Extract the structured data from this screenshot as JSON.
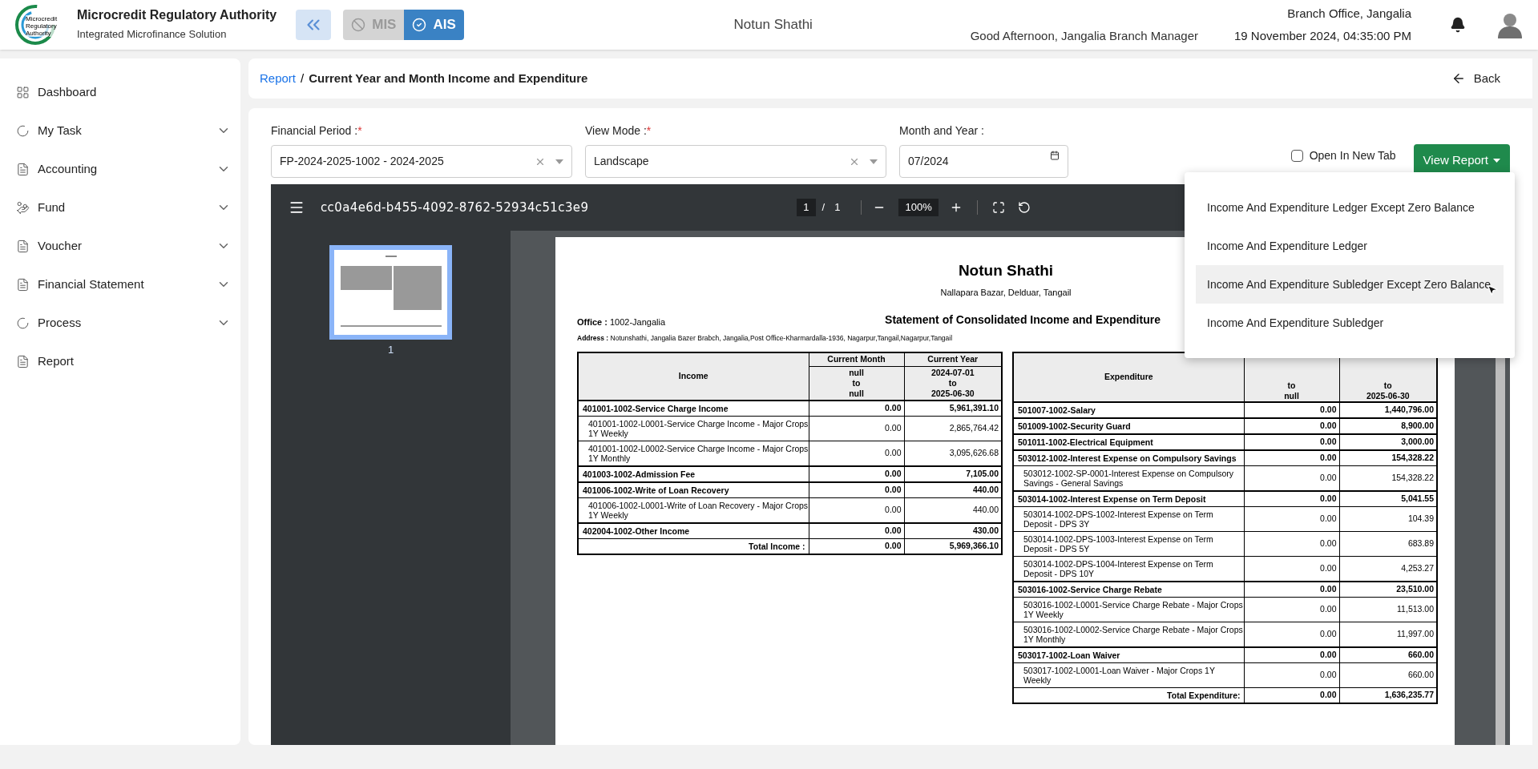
{
  "header": {
    "logo_text": "Microcredit Regulatory Authority",
    "org_name": "Microcredit Regulatory Authority",
    "org_subtitle": "Integrated Microfinance Solution",
    "modes": [
      {
        "label": "MIS",
        "selected": false
      },
      {
        "label": "AIS",
        "selected": true
      }
    ],
    "center_title": "Notun Shathi",
    "greeting": "Good Afternoon, Jangalia Branch Manager",
    "branch": "Branch Office, Jangalia",
    "datetime": "19 November 2024, 04:35:00 PM"
  },
  "sidebar": {
    "items": [
      {
        "label": "Dashboard",
        "has_submenu": false
      },
      {
        "label": "My Task",
        "has_submenu": true
      },
      {
        "label": "Accounting",
        "has_submenu": true
      },
      {
        "label": "Fund",
        "has_submenu": true
      },
      {
        "label": "Voucher",
        "has_submenu": true
      },
      {
        "label": "Financial Statement",
        "has_submenu": true
      },
      {
        "label": "Process",
        "has_submenu": true
      },
      {
        "label": "Report",
        "has_submenu": false
      }
    ]
  },
  "breadcrumb": {
    "link": "Report",
    "separator": "/",
    "current": "Current Year and Month Income and Expenditure",
    "back": "Back"
  },
  "filters": [
    {
      "kind": "select",
      "label": "Financial Period :",
      "required_mark": "*",
      "value": "FP-2024-2025-1002 - 2024-2025"
    },
    {
      "kind": "select",
      "label": "View Mode :",
      "required_mark": "*",
      "value": "Landscape"
    },
    {
      "kind": "date",
      "label": "Month and Year :",
      "value": "07/2024"
    }
  ],
  "open_in_new_tab": {
    "label": "Open In New Tab",
    "checked": false
  },
  "view_report": {
    "label": "View Report",
    "expanded": true,
    "options": [
      {
        "label": "Income And Expenditure Ledger Except Zero Balance",
        "selected": false
      },
      {
        "label": "Income And Expenditure Ledger",
        "selected": false
      },
      {
        "label": "Income And Expenditure Subledger Except Zero Balance",
        "selected": true
      },
      {
        "label": "Income And Expenditure Subledger",
        "selected": false
      }
    ]
  },
  "pdf_viewer": {
    "file_name": "cc0a4e6d-b455-4092-8762-52934c51c3e9",
    "page": "1",
    "page_separator": "/",
    "page_count": "1",
    "zoom": "100%",
    "thumbnail_label": "1",
    "document": {
      "title": "Notun Shathi",
      "address_line": "Nallapara Bazar, Delduar, Tangail",
      "office_label": "Office :",
      "office": "1002-Jangalia",
      "statement_title": "Statement of Consolidated Income and Expenditure",
      "address_label": "Address :",
      "address": "Notunshathi, Jangalia Bazer Brabch, Jangalia,Post Office-Kharmardalla-1936, Nagarpur,Tangail,Nagarpur,Tangail",
      "income_table": {
        "columns": [
          {
            "label": "Income"
          },
          {
            "label": "Current Month",
            "range": [
              "null",
              "to",
              "null"
            ]
          },
          {
            "label": "Current Year",
            "range": [
              "2024-07-01",
              "to",
              "2025-06-30"
            ]
          }
        ],
        "rows": [
          {
            "kind": "group",
            "account": "401001-1002-Service Charge Income",
            "current_month": "0.00",
            "current_year": "5,961,391.10"
          },
          {
            "kind": "sub",
            "account": "401001-1002-L0001-Service Charge Income - Major Crops 1Y Weekly",
            "current_month": "0.00",
            "current_year": "2,865,764.42"
          },
          {
            "kind": "sub",
            "account": "401001-1002-L0002-Service Charge Income - Major Crops 1Y Monthly",
            "current_month": "0.00",
            "current_year": "3,095,626.68"
          },
          {
            "kind": "group",
            "account": "401003-1002-Admission Fee",
            "current_month": "0.00",
            "current_year": "7,105.00"
          },
          {
            "kind": "group",
            "account": "401006-1002-Write of Loan Recovery",
            "current_month": "0.00",
            "current_year": "440.00"
          },
          {
            "kind": "sub",
            "account": "401006-1002-L0001-Write of Loan Recovery - Major Crops 1Y Weekly",
            "current_month": "0.00",
            "current_year": "440.00"
          },
          {
            "kind": "group",
            "account": "402004-1002-Other Income",
            "current_month": "0.00",
            "current_year": "430.00"
          },
          {
            "kind": "total",
            "account": "Total Income :",
            "current_month": "0.00",
            "current_year": "5,969,366.10"
          }
        ]
      },
      "expenditure_table": {
        "columns": [
          {
            "label": "Expenditure"
          },
          {
            "range": [
              "to",
              "null"
            ]
          },
          {
            "range": [
              "to",
              "2025-06-30"
            ]
          }
        ],
        "rows": [
          {
            "kind": "group",
            "account": "501007-1002-Salary",
            "current_month": "0.00",
            "current_year": "1,440,796.00"
          },
          {
            "kind": "group",
            "account": "501009-1002-Security Guard",
            "current_month": "0.00",
            "current_year": "8,900.00"
          },
          {
            "kind": "group",
            "account": "501011-1002-Electrical Equipment",
            "current_month": "0.00",
            "current_year": "3,000.00"
          },
          {
            "kind": "group",
            "account": "503012-1002-Interest Expense on Compulsory Savings",
            "current_month": "0.00",
            "current_year": "154,328.22"
          },
          {
            "kind": "sub",
            "account": "503012-1002-SP-0001-Interest Expense on Compulsory Savings - General Savings",
            "current_month": "0.00",
            "current_year": "154,328.22"
          },
          {
            "kind": "group",
            "account": "503014-1002-Interest Expense on Term Deposit",
            "current_month": "0.00",
            "current_year": "5,041.55"
          },
          {
            "kind": "sub",
            "account": "503014-1002-DPS-1002-Interest Expense on Term Deposit - DPS 3Y",
            "current_month": "0.00",
            "current_year": "104.39"
          },
          {
            "kind": "sub",
            "account": "503014-1002-DPS-1003-Interest Expense on Term Deposit - DPS 5Y",
            "current_month": "0.00",
            "current_year": "683.89"
          },
          {
            "kind": "sub",
            "account": "503014-1002-DPS-1004-Interest Expense on Term Deposit - DPS 10Y",
            "current_month": "0.00",
            "current_year": "4,253.27"
          },
          {
            "kind": "group",
            "account": "503016-1002-Service Charge Rebate",
            "current_month": "0.00",
            "current_year": "23,510.00"
          },
          {
            "kind": "sub",
            "account": "503016-1002-L0001-Service Charge Rebate - Major Crops 1Y Weekly",
            "current_month": "0.00",
            "current_year": "11,513.00"
          },
          {
            "kind": "sub",
            "account": "503016-1002-L0002-Service Charge Rebate - Major Crops 1Y Monthly",
            "current_month": "0.00",
            "current_year": "11,997.00"
          },
          {
            "kind": "group",
            "account": "503017-1002-Loan Waiver",
            "current_month": "0.00",
            "current_year": "660.00"
          },
          {
            "kind": "sub",
            "account": "503017-1002-L0001-Loan Waiver - Major Crops 1Y Weekly",
            "current_month": "0.00",
            "current_year": "660.00"
          },
          {
            "kind": "total",
            "account": "Total Expenditure:",
            "current_month": "0.00",
            "current_year": "1,636,235.77"
          }
        ]
      }
    }
  }
}
